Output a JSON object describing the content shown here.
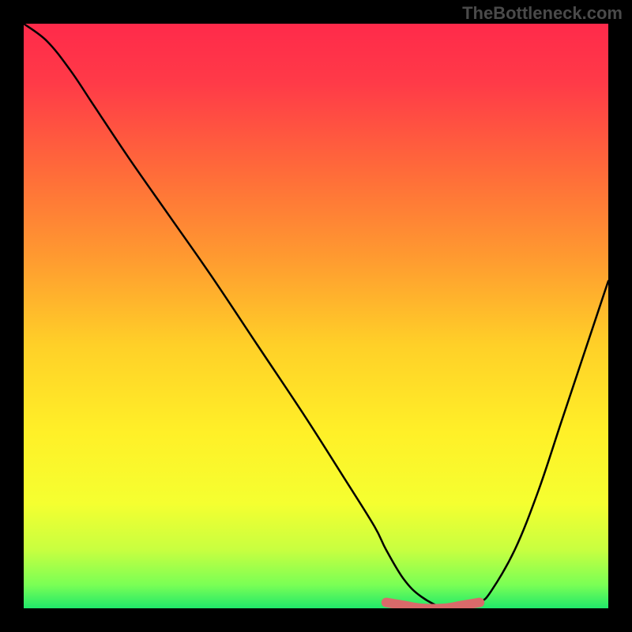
{
  "watermark": "TheBottleneck.com",
  "chart_data": {
    "type": "line",
    "title": "",
    "xlabel": "",
    "ylabel": "",
    "xlim": [
      0,
      100
    ],
    "ylim": [
      0,
      100
    ],
    "series": [
      {
        "name": "bottleneck-curve",
        "x": [
          0,
          4,
          8,
          12,
          18,
          25,
          32,
          40,
          48,
          55,
          60,
          62,
          65,
          68,
          72,
          75,
          78,
          80,
          84,
          88,
          92,
          96,
          100
        ],
        "values": [
          100,
          97,
          92,
          86,
          77,
          67,
          57,
          45,
          33,
          22,
          14,
          10,
          5,
          2,
          0,
          0,
          1,
          3,
          10,
          20,
          32,
          44,
          56
        ]
      },
      {
        "name": "optimal-range-marker",
        "x": [
          62,
          65,
          68,
          72,
          75,
          78
        ],
        "values": [
          1,
          0.5,
          0,
          0,
          0.5,
          1
        ]
      }
    ],
    "gradient_stops": [
      {
        "offset": 0.0,
        "color": "#ff2a4a"
      },
      {
        "offset": 0.1,
        "color": "#ff3a48"
      },
      {
        "offset": 0.25,
        "color": "#ff6a3a"
      },
      {
        "offset": 0.4,
        "color": "#ff9a30"
      },
      {
        "offset": 0.55,
        "color": "#ffd028"
      },
      {
        "offset": 0.7,
        "color": "#fff028"
      },
      {
        "offset": 0.82,
        "color": "#f5ff30"
      },
      {
        "offset": 0.9,
        "color": "#c8ff40"
      },
      {
        "offset": 0.96,
        "color": "#7aff55"
      },
      {
        "offset": 1.0,
        "color": "#20e86a"
      }
    ],
    "marker_color": "#d96a6a"
  }
}
